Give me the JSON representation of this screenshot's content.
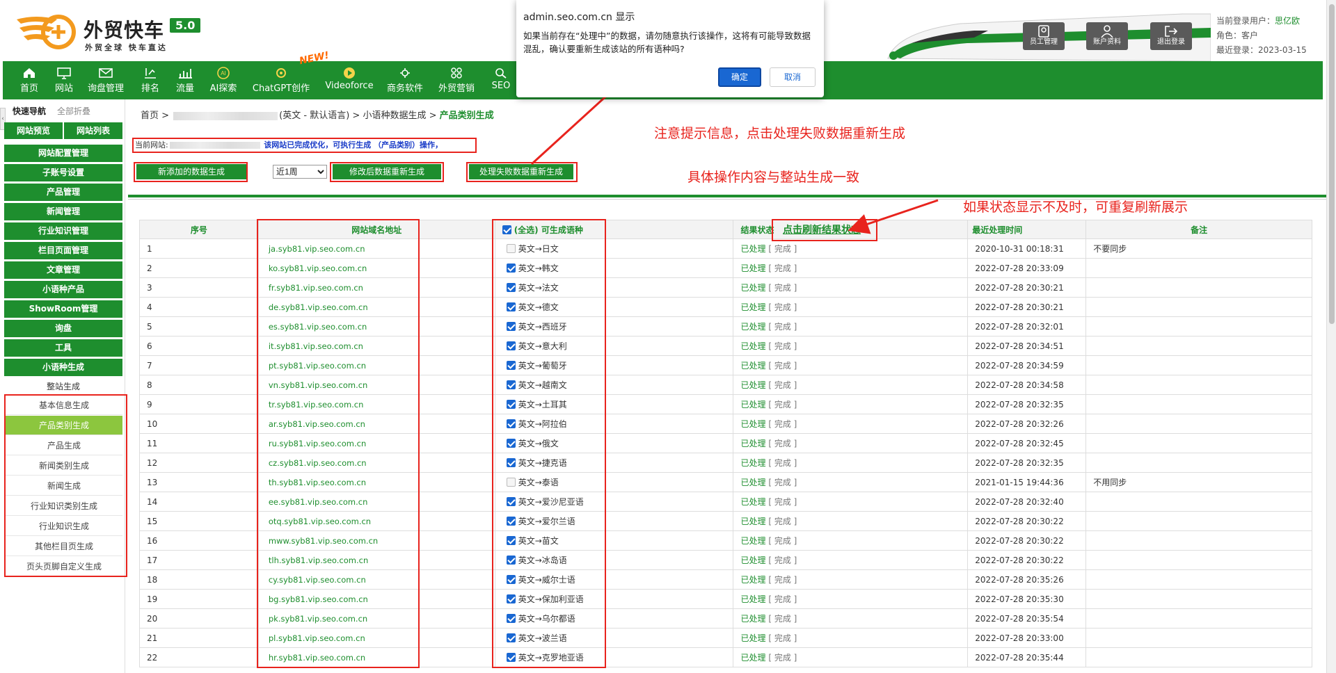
{
  "brand": {
    "name": "外贸快车",
    "version": "5.0",
    "slogan": "外贸全球 快车直达",
    "accent": "#1e8e2e"
  },
  "header_buttons": [
    {
      "label": "员工管理",
      "icon": "employee-icon"
    },
    {
      "label": "账户资料",
      "icon": "account-icon"
    },
    {
      "label": "退出登录",
      "icon": "logout-icon"
    }
  ],
  "user": {
    "login_label": "当前登录用户：",
    "login_name": "思亿欧",
    "role_label": "角色：",
    "role": "客户",
    "last_label": "最近登录：",
    "last": "2023-03-15"
  },
  "nav": {
    "new_badge": "NEW!",
    "items": [
      {
        "label": "首页",
        "icon": "home-icon"
      },
      {
        "label": "网站",
        "icon": "monitor-icon"
      },
      {
        "label": "询盘管理",
        "icon": "mail-icon"
      },
      {
        "label": "排名",
        "icon": "ranking-icon"
      },
      {
        "label": "流量",
        "icon": "traffic-icon"
      },
      {
        "label": "AI探索",
        "icon": "ai-icon"
      },
      {
        "label": "ChatGPT创作",
        "icon": "chatgpt-icon"
      },
      {
        "label": "Videoforce",
        "icon": "video-icon"
      },
      {
        "label": "商务软件",
        "icon": "software-icon"
      },
      {
        "label": "外贸营销",
        "icon": "marketing-icon"
      },
      {
        "label": "SEO",
        "icon": "seo-icon"
      }
    ]
  },
  "sidebar": {
    "tab_quick": "快速导航",
    "tab_collapse_all": "全部折叠",
    "top_buttons": [
      "网站预览",
      "网站列表"
    ],
    "menu": [
      "网站配置管理",
      "子账号设置",
      "产品管理",
      "新闻管理",
      "行业知识管理",
      "栏目页面管理",
      "文章管理",
      "小语种产品",
      "ShowRoom管理",
      "询盘",
      "工具",
      "小语种生成"
    ],
    "sub_title": "整站生成",
    "sub_items": [
      "基本信息生成",
      "产品类别生成",
      "产品生成",
      "新闻类别生成",
      "新闻生成",
      "行业知识类别生成",
      "行业知识生成",
      "其他栏目页生成",
      "页头页脚自定义生成"
    ],
    "active_sub": "产品类别生成"
  },
  "breadcrumb": {
    "home": "首页 >",
    "lang": "(英文 - 默认语言) >",
    "section": "小语种数据生成 >",
    "current": "产品类别生成"
  },
  "site_line": {
    "prefix": "当前网站:",
    "note": "该网站已完成优化，可执行生成 （产品类别）操作，"
  },
  "actions": {
    "new_data": "新添加的数据生成",
    "period": "近1周",
    "modified": "修改后数据重新生成",
    "failed": "处理失败数据重新生成"
  },
  "annotations": {
    "note1": "注意提示信息，点击处理失败数据重新生成",
    "note2": "具体操作内容与整站生成一致",
    "note3": "如果状态显示不及时，可重复刷新展示"
  },
  "table": {
    "headers": {
      "idx": "序号",
      "domain": "网站域名地址",
      "select_all": "(全选) 可生成语种",
      "status": "结果状态",
      "refresh": "点击刷新结果状态",
      "time": "最近处理时间",
      "remark": "备注"
    },
    "status_a": "已处理",
    "status_b": "[ 完成 ]",
    "rows": [
      {
        "idx": "1",
        "domain": "ja.syb81.vip.seo.com.cn",
        "checked": false,
        "lang": "英文→日文",
        "time": "2020-10-31 00:18:31",
        "remark": "不要同步"
      },
      {
        "idx": "2",
        "domain": "ko.syb81.vip.seo.com.cn",
        "checked": true,
        "lang": "英文→韩文",
        "time": "2022-07-28 20:33:09",
        "remark": ""
      },
      {
        "idx": "3",
        "domain": "fr.syb81.vip.seo.com.cn",
        "checked": true,
        "lang": "英文→法文",
        "time": "2022-07-28 20:30:21",
        "remark": ""
      },
      {
        "idx": "4",
        "domain": "de.syb81.vip.seo.com.cn",
        "checked": true,
        "lang": "英文→德文",
        "time": "2022-07-28 20:30:21",
        "remark": ""
      },
      {
        "idx": "5",
        "domain": "es.syb81.vip.seo.com.cn",
        "checked": true,
        "lang": "英文→西班牙",
        "time": "2022-07-28 20:32:01",
        "remark": ""
      },
      {
        "idx": "6",
        "domain": "it.syb81.vip.seo.com.cn",
        "checked": true,
        "lang": "英文→意大利",
        "time": "2022-07-28 20:34:51",
        "remark": ""
      },
      {
        "idx": "7",
        "domain": "pt.syb81.vip.seo.com.cn",
        "checked": true,
        "lang": "英文→葡萄牙",
        "time": "2022-07-28 20:34:59",
        "remark": ""
      },
      {
        "idx": "8",
        "domain": "vn.syb81.vip.seo.com.cn",
        "checked": true,
        "lang": "英文→越南文",
        "time": "2022-07-28 20:34:58",
        "remark": ""
      },
      {
        "idx": "9",
        "domain": "tr.syb81.vip.seo.com.cn",
        "checked": true,
        "lang": "英文→土耳其",
        "time": "2022-07-28 20:32:35",
        "remark": ""
      },
      {
        "idx": "10",
        "domain": "ar.syb81.vip.seo.com.cn",
        "checked": true,
        "lang": "英文→阿拉伯",
        "time": "2022-07-28 20:32:26",
        "remark": ""
      },
      {
        "idx": "11",
        "domain": "ru.syb81.vip.seo.com.cn",
        "checked": true,
        "lang": "英文→俄文",
        "time": "2022-07-28 20:32:45",
        "remark": ""
      },
      {
        "idx": "12",
        "domain": "cz.syb81.vip.seo.com.cn",
        "checked": true,
        "lang": "英文→捷克语",
        "time": "2022-07-28 20:32:35",
        "remark": ""
      },
      {
        "idx": "13",
        "domain": "th.syb81.vip.seo.com.cn",
        "checked": false,
        "lang": "英文→泰语",
        "time": "2021-01-15 19:44:36",
        "remark": "不用同步"
      },
      {
        "idx": "14",
        "domain": "ee.syb81.vip.seo.com.cn",
        "checked": true,
        "lang": "英文→爱沙尼亚语",
        "time": "2022-07-28 20:32:40",
        "remark": ""
      },
      {
        "idx": "15",
        "domain": "otq.syb81.vip.seo.com.cn",
        "checked": true,
        "lang": "英文→爱尔兰语",
        "time": "2022-07-28 20:30:22",
        "remark": ""
      },
      {
        "idx": "16",
        "domain": "mww.syb81.vip.seo.com.cn",
        "checked": true,
        "lang": "英文→苗文",
        "time": "2022-07-28 20:30:22",
        "remark": ""
      },
      {
        "idx": "17",
        "domain": "tlh.syb81.vip.seo.com.cn",
        "checked": true,
        "lang": "英文→冰岛语",
        "time": "2022-07-28 20:30:22",
        "remark": ""
      },
      {
        "idx": "18",
        "domain": "cy.syb81.vip.seo.com.cn",
        "checked": true,
        "lang": "英文→威尔士语",
        "time": "2022-07-28 20:35:26",
        "remark": ""
      },
      {
        "idx": "19",
        "domain": "bg.syb81.vip.seo.com.cn",
        "checked": true,
        "lang": "英文→保加利亚语",
        "time": "2022-07-28 20:35:30",
        "remark": ""
      },
      {
        "idx": "20",
        "domain": "pk.syb81.vip.seo.com.cn",
        "checked": true,
        "lang": "英文→乌尔都语",
        "time": "2022-07-28 20:35:54",
        "remark": ""
      },
      {
        "idx": "21",
        "domain": "pl.syb81.vip.seo.com.cn",
        "checked": true,
        "lang": "英文→波兰语",
        "time": "2022-07-28 20:33:00",
        "remark": ""
      },
      {
        "idx": "22",
        "domain": "hr.syb81.vip.seo.com.cn",
        "checked": true,
        "lang": "英文→克罗地亚语",
        "time": "2022-07-28 20:35:44",
        "remark": ""
      }
    ]
  },
  "dialog": {
    "title": "admin.seo.com.cn 显示",
    "message": "如果当前存在“处理中”的数据，请勿随意执行该操作，这将有可能导致数据混乱，确认要重新生成该站的所有语种吗?",
    "ok": "确定",
    "cancel": "取消"
  }
}
